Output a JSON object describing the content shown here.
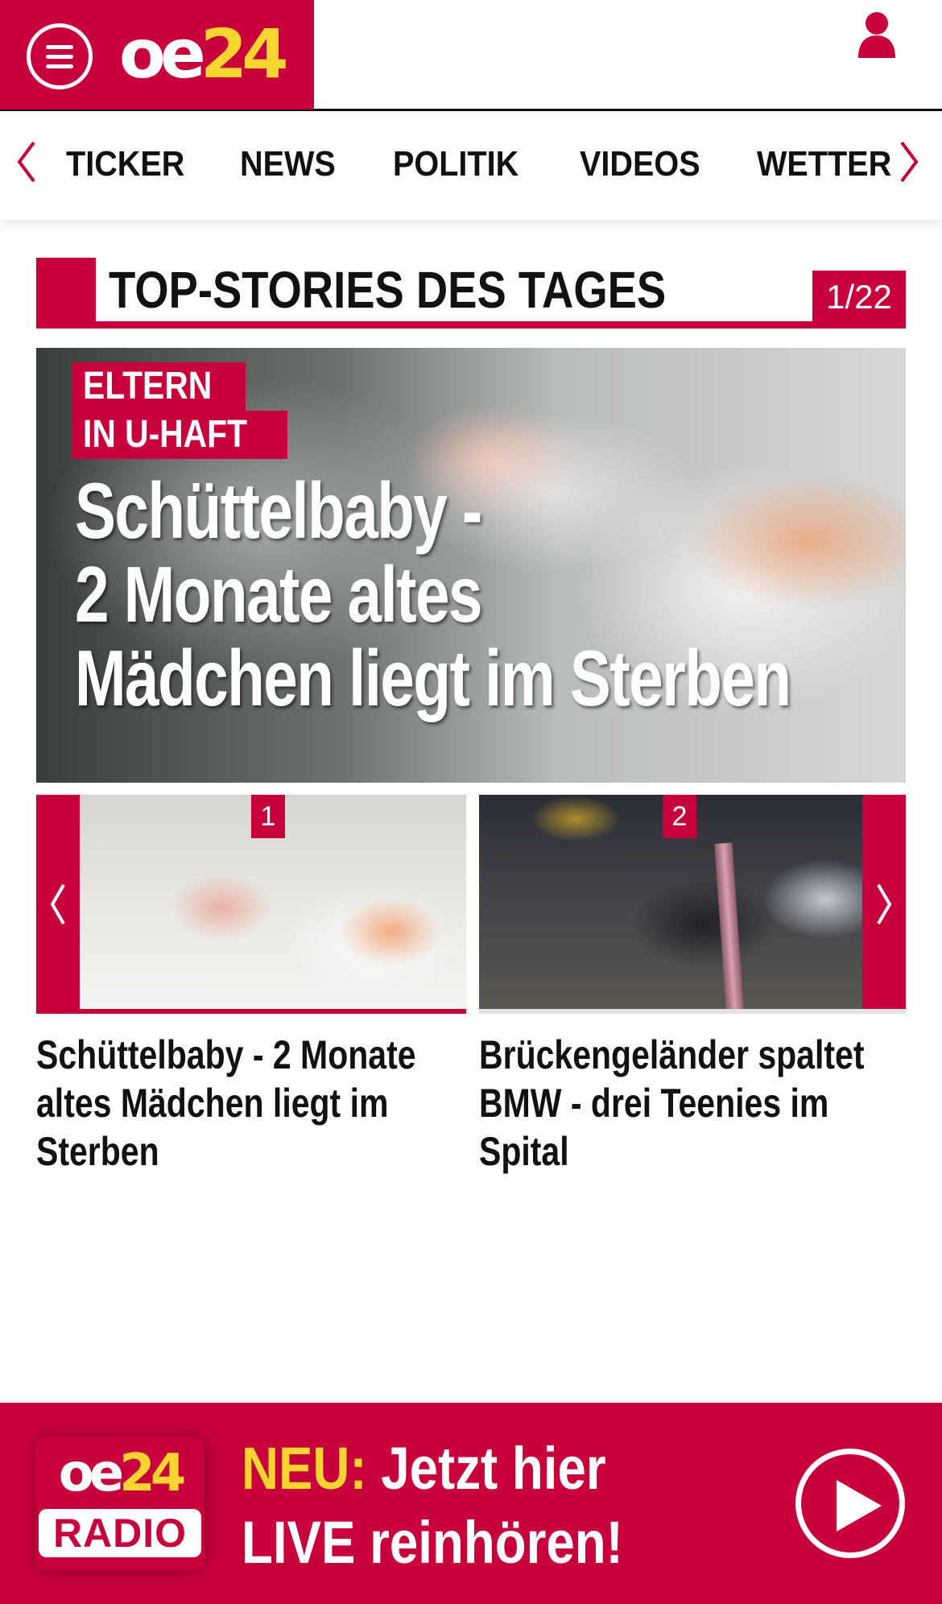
{
  "header": {
    "logo": {
      "oe": "oe",
      "num": "24"
    },
    "icons": {
      "menu": "hamburger-menu-icon",
      "user": "user-icon"
    }
  },
  "nav": {
    "items": [
      "TICKER",
      "NEWS",
      "POLITIK",
      "VIDEOS",
      "WETTER"
    ]
  },
  "section": {
    "title": "TOP-STORIES DES TAGES",
    "counter": "1/22"
  },
  "hero": {
    "kicker_line1": "ELTERN",
    "kicker_line2": "IN U-HAFT",
    "headline_lines": [
      "Schüttelbaby -",
      "2 Monate altes",
      "Mädchen liegt im Sterben"
    ]
  },
  "carousel": {
    "cards": [
      {
        "badge": "1",
        "title_lines": [
          "Schüttelbaby - 2 Monate",
          "altes Mädchen liegt im",
          "Sterben"
        ]
      },
      {
        "badge": "2",
        "title_lines": [
          "Brückengeländer spaltet",
          "BMW - drei Teenies im",
          "Spital"
        ]
      }
    ]
  },
  "radio": {
    "logo_oe": "oe",
    "logo_num": "24",
    "logo_radio": "RADIO",
    "neu": "NEU:",
    "line1_rest": " Jetzt hier",
    "line2": "LIVE reinhören!"
  },
  "colors": {
    "brand_red": "#c8003c",
    "brand_yellow": "#f7d530"
  }
}
